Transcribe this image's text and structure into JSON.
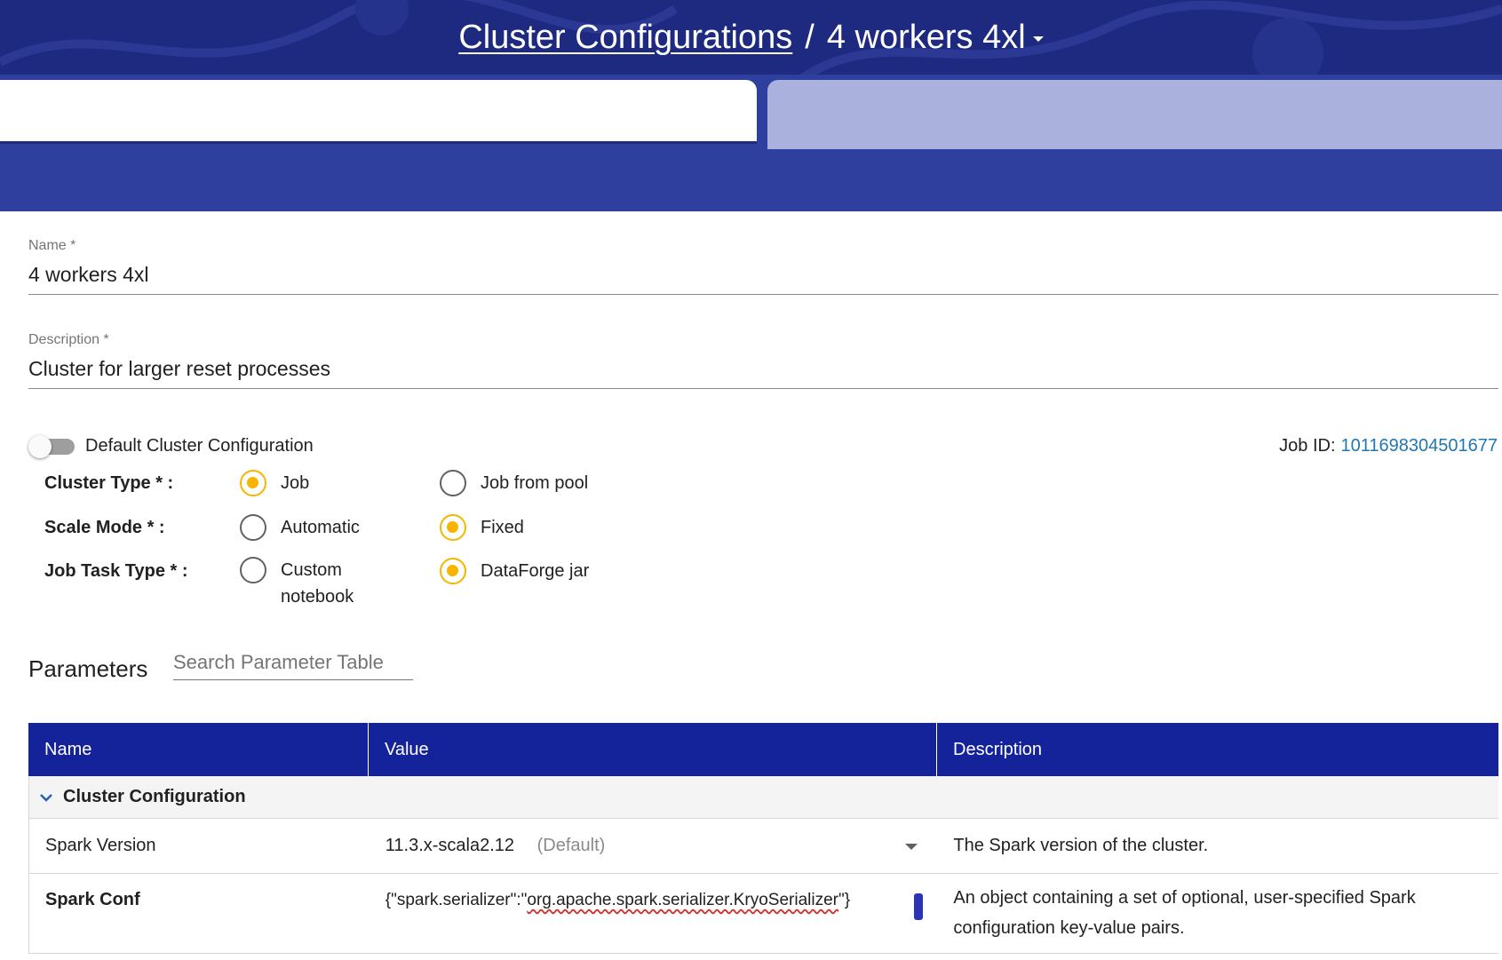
{
  "header": {
    "breadcrumb_link": "Cluster Configurations",
    "separator": "/",
    "current": "4 workers 4xl",
    "dropdown_icon": "caret-down-icon"
  },
  "form": {
    "name": {
      "label": "Name *",
      "value": "4 workers 4xl"
    },
    "description": {
      "label": "Description *",
      "value": "Cluster for larger reset processes"
    },
    "default_toggle": {
      "label": "Default Cluster Configuration",
      "on": false
    },
    "job_id": {
      "label": "Job ID:",
      "value": "1011698304501677"
    }
  },
  "radios": {
    "cluster_type": {
      "label": "Cluster Type * :",
      "options": [
        {
          "label": "Job",
          "checked": true
        },
        {
          "label": "Job from pool",
          "checked": false
        }
      ]
    },
    "scale_mode": {
      "label": "Scale Mode * :",
      "options": [
        {
          "label": "Automatic",
          "checked": false
        },
        {
          "label": "Fixed",
          "checked": true
        }
      ]
    },
    "job_task_type": {
      "label": "Job Task Type * :",
      "options": [
        {
          "label": "Custom notebook",
          "checked": false
        },
        {
          "label": "DataForge jar",
          "checked": true
        }
      ]
    }
  },
  "parameters": {
    "title": "Parameters",
    "search_placeholder": "Search Parameter Table",
    "columns": [
      "Name",
      "Value",
      "Description"
    ],
    "group": {
      "label": "Cluster Configuration",
      "expanded": true
    },
    "rows": [
      {
        "name": "Spark Version",
        "value": "11.3.x-scala2.12",
        "value_note": "(Default)",
        "description": "The Spark version of the cluster."
      },
      {
        "name": "Spark Conf",
        "value_prefix": "{\"spark.serializer\":\"",
        "value_flagged": "org.apache.spark.serializer.KryoSerializer",
        "value_suffix": "\"}",
        "description": "An object containing a set of optional, user-specified Spark configuration key-value pairs."
      }
    ]
  },
  "colors": {
    "header_bg": "#1e2a80",
    "band_bg": "#2f3f9e",
    "table_header_bg": "#15239b",
    "radio_checked": "#f7b500",
    "link": "#1f77b4"
  }
}
